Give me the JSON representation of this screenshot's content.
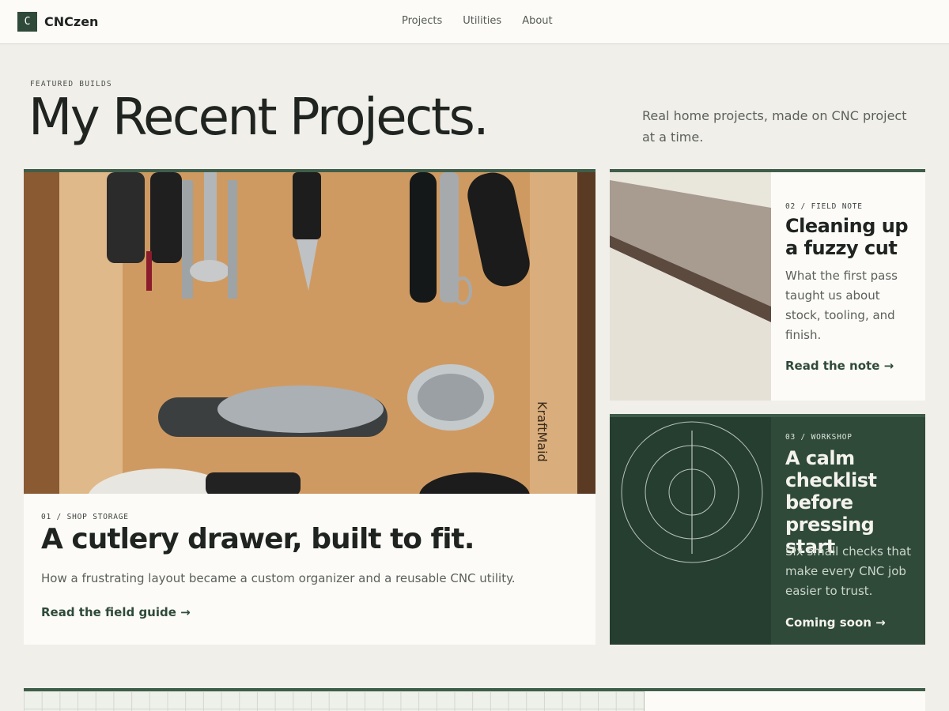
{
  "header": {
    "logo_letter": "C",
    "brand": "CNCzen",
    "nav": [
      "Projects",
      "Utilities",
      "About"
    ]
  },
  "hero": {
    "eyebrow": "FEATURED BUILDS",
    "title": "My Recent Projects.",
    "subtitle": "Real home projects, made on CNC project at a time."
  },
  "cards": {
    "main": {
      "kicker": "01 / SHOP STORAGE",
      "title": "A cutlery drawer, built to fit.",
      "description": "How a frustrating layout became a custom organizer and a reusable CNC utility.",
      "link": "Read the field guide →",
      "image": "photo of kitchen utensils in a wooden drawer"
    },
    "note": {
      "kicker": "02 / FIELD NOTE",
      "title": "Cleaning up a fuzzy cut",
      "description": "What the first pass taught us about stock, tooling, and finish.",
      "link": "Read the note →",
      "image": "photo of a cut plywood board edge"
    },
    "workshop": {
      "kicker": "03 / WORKSHOP",
      "title": "A calm checklist before pressing start",
      "description": "Six small checks that make every CNC job easier to trust.",
      "link": "Coming soon →",
      "icon": "concentric-circles-target-icon"
    }
  },
  "colors": {
    "accent_green": "#2f4a39",
    "page_background": "#f1efea",
    "card_background": "#fcfbf7"
  }
}
